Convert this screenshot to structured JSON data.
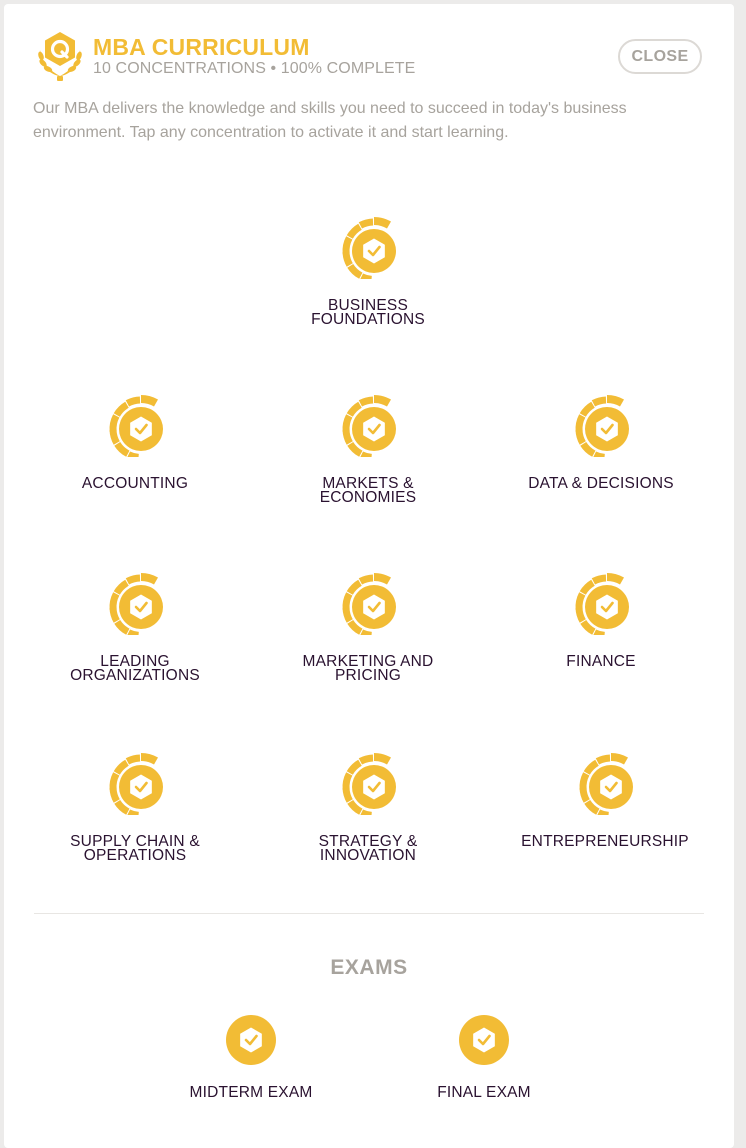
{
  "header": {
    "title": "MBA CURRICULUM",
    "subtitle": "10 CONCENTRATIONS • 100% COMPLETE",
    "close_label": "CLOSE",
    "logo_icon": "laurel-hexagon-logo-icon"
  },
  "description": "Our MBA delivers the knowledge and skills you need to succeed in today's business environment. Tap any concentration to activate it and start learning.",
  "colors": {
    "accent": "#f2bc35",
    "muted": "#a7a39d",
    "label": "#2a1230"
  },
  "concentrations": [
    {
      "line1": "BUSINESS",
      "line2": "FOUNDATIONS",
      "icon": "progress-ring-check-icon"
    },
    {
      "line1": "ACCOUNTING",
      "line2": "",
      "icon": "progress-ring-check-icon"
    },
    {
      "line1": "MARKETS &",
      "line2": "ECONOMIES",
      "icon": "progress-ring-check-icon"
    },
    {
      "line1": "DATA & DECISIONS",
      "line2": "",
      "icon": "progress-ring-check-icon"
    },
    {
      "line1": "LEADING",
      "line2": "ORGANIZATIONS",
      "icon": "progress-ring-check-icon"
    },
    {
      "line1": "MARKETING AND",
      "line2": "PRICING",
      "icon": "progress-ring-check-icon"
    },
    {
      "line1": "FINANCE",
      "line2": "",
      "icon": "progress-ring-check-icon"
    },
    {
      "line1": "SUPPLY CHAIN &",
      "line2": "OPERATIONS",
      "icon": "progress-ring-check-icon"
    },
    {
      "line1": "STRATEGY &",
      "line2": "INNOVATION",
      "icon": "progress-ring-check-icon"
    },
    {
      "line1": "ENTREPRENEURSHIP",
      "line2": "",
      "icon": "progress-ring-check-icon"
    }
  ],
  "exams": {
    "title": "EXAMS",
    "items": [
      {
        "label": "MIDTERM EXAM",
        "icon": "circle-check-icon"
      },
      {
        "label": "FINAL EXAM",
        "icon": "circle-check-icon"
      }
    ]
  }
}
